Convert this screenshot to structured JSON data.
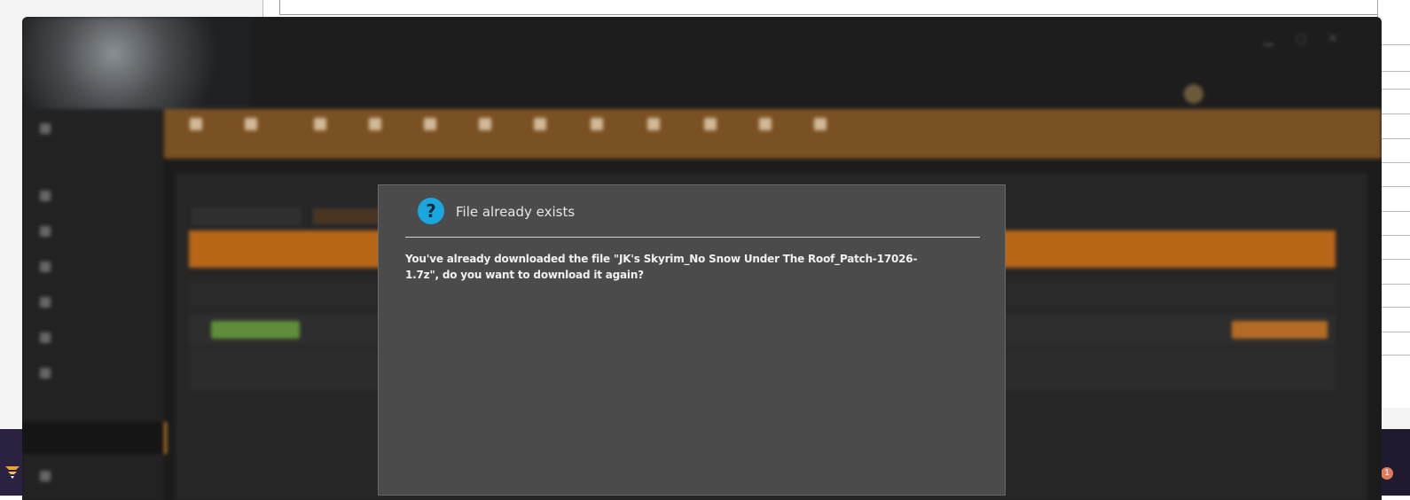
{
  "dialog": {
    "icon": "question-icon",
    "icon_glyph": "?",
    "title": "File already exists",
    "message": "You've already downloaded the file \"JK's Skyrim_No Snow Under The Roof_Patch-17026-1.7z\", do you want to download it again?"
  },
  "tray": {
    "notification_count": "1"
  },
  "colors": {
    "accent": "#b76617",
    "dialog_bg": "#4b4b4b",
    "icon_blue": "#19a7e0"
  }
}
